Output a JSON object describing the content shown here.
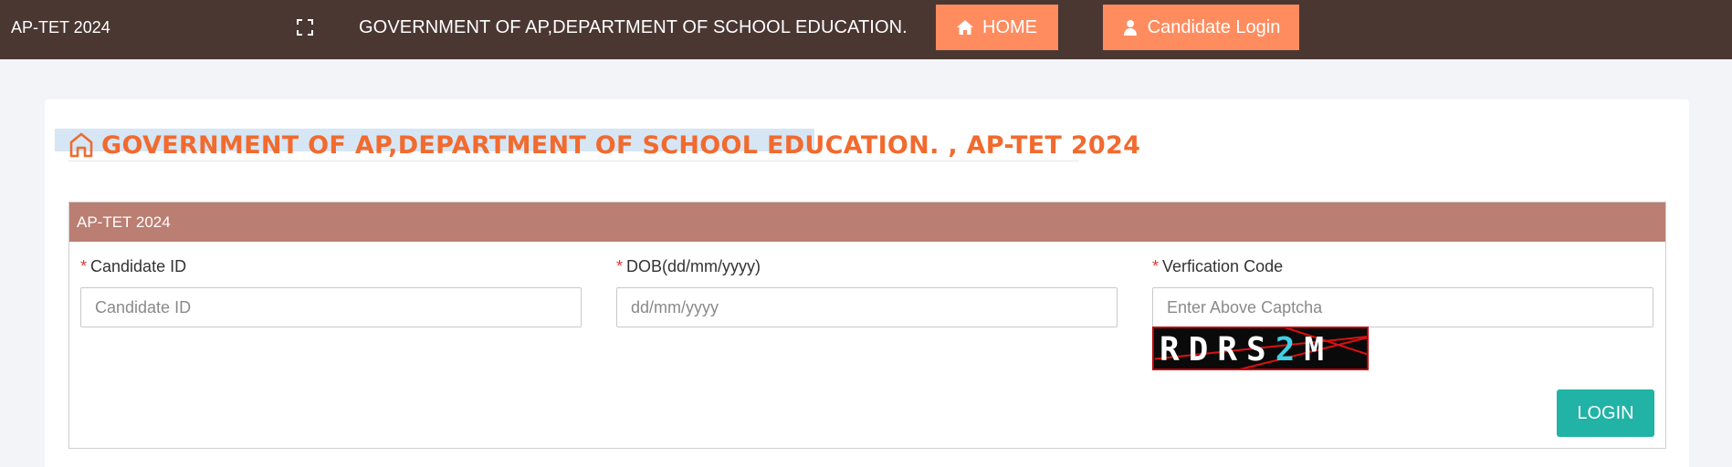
{
  "header": {
    "brand": "AP-TET 2024",
    "title": "GOVERNMENT OF AP,DEPARTMENT OF SCHOOL EDUCATION.",
    "home_label": "HOME",
    "candidate_login_label": "Candidate Login"
  },
  "main": {
    "heading": "GOVERNMENT OF AP,DEPARTMENT OF SCHOOL EDUCATION. , AP-TET 2024",
    "panel_title": "AP-TET 2024",
    "required_mark": "*",
    "fields": {
      "candidate_id": {
        "label": "Candidate ID",
        "placeholder": "Candidate ID",
        "value": ""
      },
      "dob": {
        "label": "DOB(dd/mm/yyyy)",
        "placeholder": "dd/mm/yyyy",
        "value": ""
      },
      "verification": {
        "label": "Verfication Code",
        "placeholder": "Enter Above Captcha",
        "value": ""
      }
    },
    "captcha": {
      "chars_white": "RDRS",
      "chars_cyan": "2",
      "chars_white2": "M"
    },
    "login_label": "LOGIN"
  },
  "colors": {
    "topbar": "#4a3732",
    "nav_button": "#ff8c5f",
    "heading": "#f26a2e",
    "panel_header": "#bb7e72",
    "login_button": "#21b3a5",
    "required": "#e03c31"
  },
  "icons": {
    "expand": "expand-icon",
    "home": "home-icon",
    "user": "user-icon",
    "heading": "home-outline-icon"
  }
}
